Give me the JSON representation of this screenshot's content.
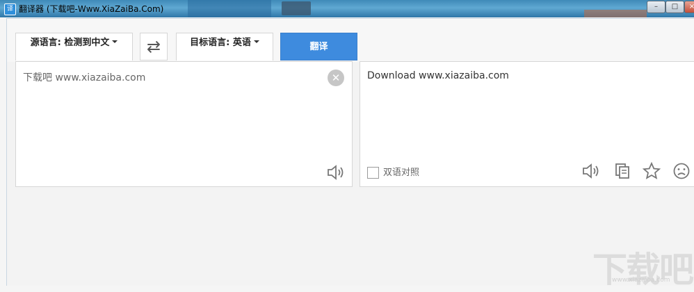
{
  "window": {
    "title": "翻译器 (下载吧-Www.XiaZaiBa.Com)",
    "app_icon": "译",
    "minimize": "–",
    "maximize": "□",
    "close": "×"
  },
  "toolbar": {
    "source_lang_label": "源语言: 检测到中文",
    "swap_glyph": "⇄",
    "target_lang_label": "目标语言: 英语",
    "translate_label": "翻译"
  },
  "source": {
    "text": "下载吧  www.xiazaiba.com",
    "clear_glyph": "✕"
  },
  "target": {
    "text": "Download www.xiazaiba.com",
    "bilingual_label": "双语对照"
  },
  "watermark": {
    "text": "下载吧",
    "url": "www.xiazaiba.com"
  },
  "colors": {
    "accent": "#3e8bde",
    "titlebar": "#4a93c4"
  },
  "icons": {
    "source_panel": [
      "speaker-icon",
      "clear-icon"
    ],
    "target_panel": [
      "speaker-icon",
      "copy-icon",
      "star-icon",
      "sad-face-icon"
    ]
  }
}
